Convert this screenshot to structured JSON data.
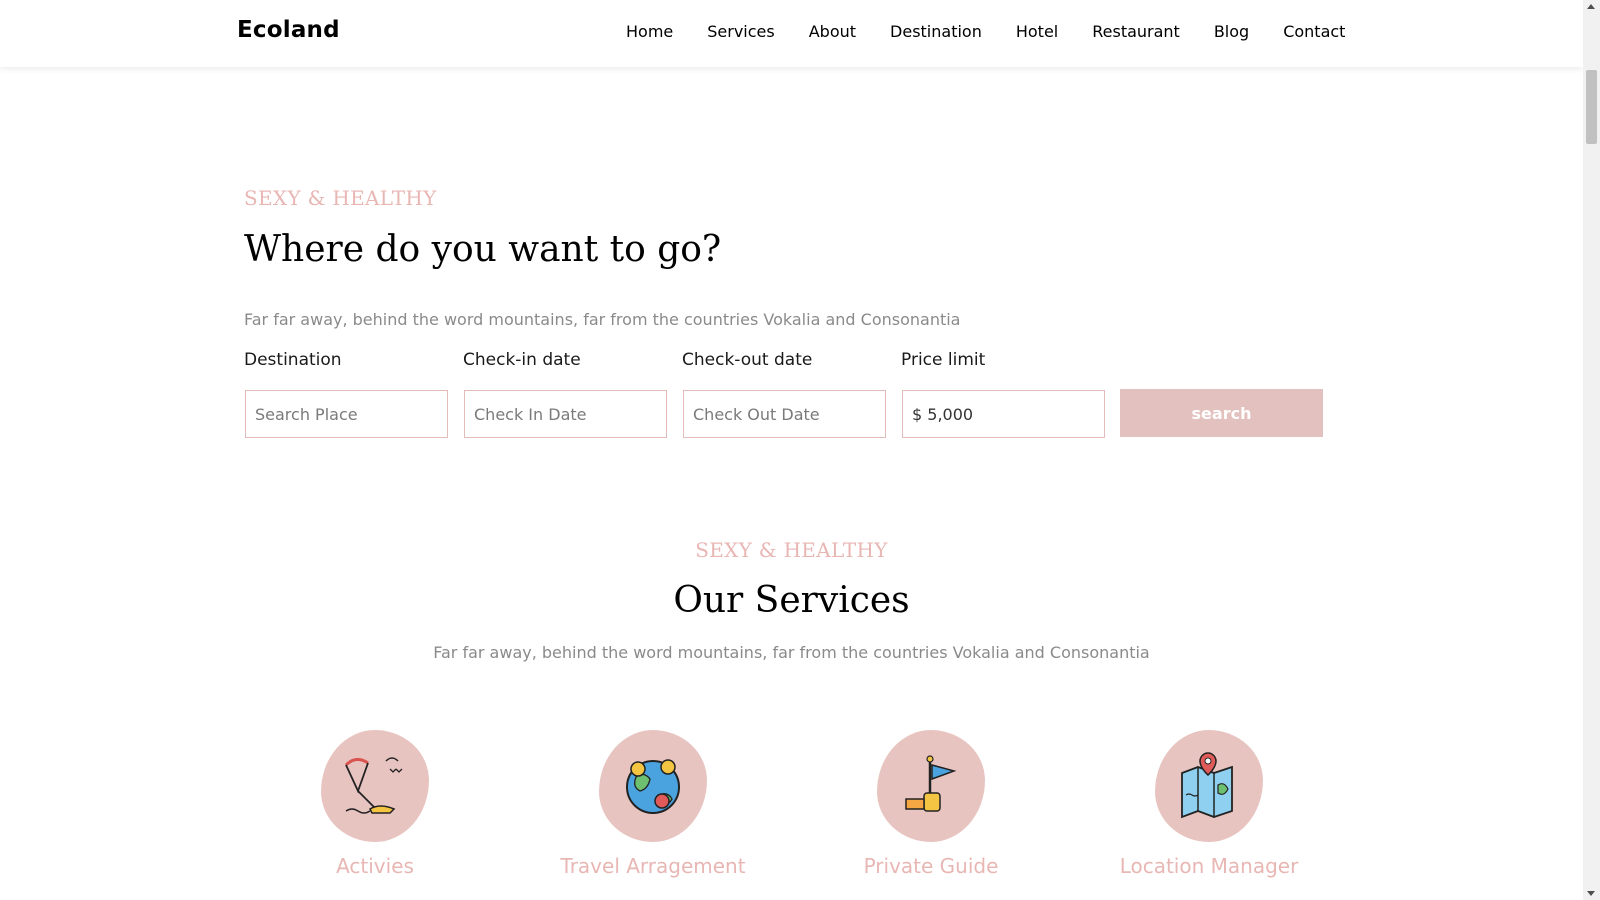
{
  "navbar": {
    "brand": "Ecoland",
    "links": [
      "Home",
      "Services",
      "About",
      "Destination",
      "Hotel",
      "Restaurant",
      "Blog",
      "Contact"
    ]
  },
  "search_section": {
    "eyebrow": "SEXY & HEALTHY",
    "heading": "Where do you want to go?",
    "subtitle": "Far far away, behind the word mountains, far from the countries Vokalia and Consonantia",
    "fields": [
      {
        "label": "Destination",
        "placeholder": "Search Place"
      },
      {
        "label": "Check-in date",
        "placeholder": "Check In Date"
      },
      {
        "label": "Check-out date",
        "placeholder": "Check Out Date"
      },
      {
        "label": "Price limit",
        "value": "$ 5,000"
      }
    ],
    "search_label": "search"
  },
  "services_section": {
    "eyebrow": "SEXY & HEALTHY",
    "heading": "Our Services",
    "subtitle": "Far far away, behind the word mountains, far from the countries Vokalia and Consonantia",
    "items": [
      {
        "title": "Activies",
        "icon": "paraglide-icon"
      },
      {
        "title": "Travel Arragement",
        "icon": "globe-pins-icon"
      },
      {
        "title": "Private Guide",
        "icon": "flag-hand-icon"
      },
      {
        "title": "Location Manager",
        "icon": "map-pin-icon"
      }
    ]
  },
  "colors": {
    "accent": "#e8b7b4",
    "button": "#e3c1be",
    "blob": "#e8c4c1"
  }
}
